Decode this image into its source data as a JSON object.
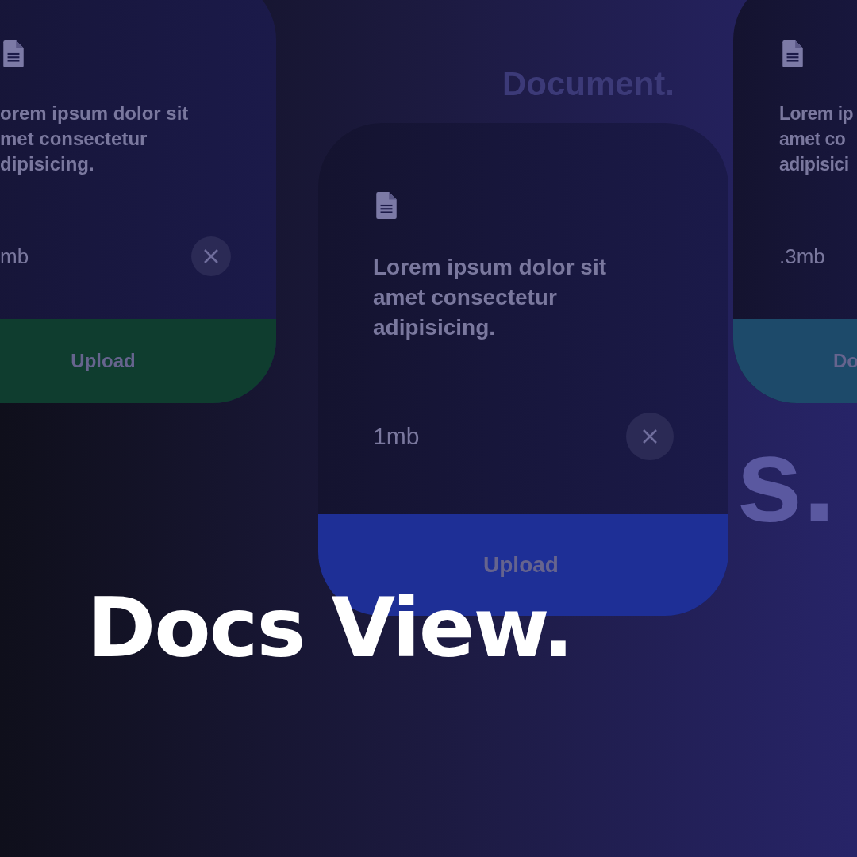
{
  "background_words": [
    "Document.",
    "s."
  ],
  "cards": [
    {
      "description": [
        "orem ipsum dolor sit",
        "met consectetur",
        "dipisicing."
      ],
      "size": "mb",
      "button": {
        "label": "Upload",
        "color": "#0f3d2f"
      }
    },
    {
      "description": [
        "Lorem ipsum dolor sit",
        "amet consectetur",
        "adipisicing."
      ],
      "size": "1mb",
      "button": {
        "label": "Upload",
        "color": "#1e2f96"
      }
    },
    {
      "description": [
        "Lorem ip",
        "amet co",
        "adipisici"
      ],
      "size": ".3mb",
      "button": {
        "label": "Do",
        "color": "#1d4a6a"
      }
    }
  ],
  "headline": "Docs View."
}
